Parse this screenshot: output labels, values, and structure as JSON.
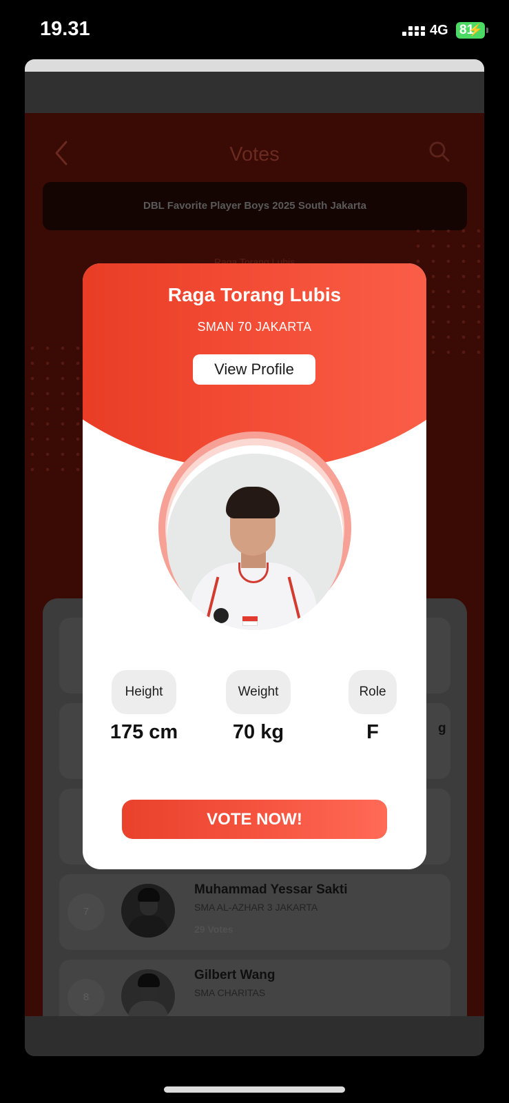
{
  "status_bar": {
    "time": "19.31",
    "network": "4G",
    "battery": "81"
  },
  "header": {
    "title": "Votes"
  },
  "event": {
    "name": "DBL Favorite Player Boys 2025 South Jakarta"
  },
  "background_name": "Raga Torang Lubis",
  "list": {
    "partial_text": "g",
    "rows": [
      {
        "rank": "7",
        "name": "Muhammad Yessar Sakti",
        "school": "SMA AL-AZHAR 3 JAKARTA",
        "votes": "29 Votes"
      },
      {
        "rank": "8",
        "name": "Gilbert Wang",
        "school": "SMA CHARITAS",
        "votes": ""
      }
    ]
  },
  "modal": {
    "name": "Raga Torang Lubis",
    "school": "SMAN 70 JAKARTA",
    "view_profile": "View Profile",
    "stats": [
      {
        "label": "Height",
        "value": "175 cm"
      },
      {
        "label": "Weight",
        "value": "70 kg"
      },
      {
        "label": "Role",
        "value": "F"
      }
    ],
    "vote_button": "VOTE NOW!"
  },
  "colors": {
    "accent": "#f24a33",
    "battery": "#4cd964"
  },
  "icons": [
    "back-icon",
    "search-icon",
    "signal-icon",
    "battery-icon",
    "charging-icon"
  ]
}
